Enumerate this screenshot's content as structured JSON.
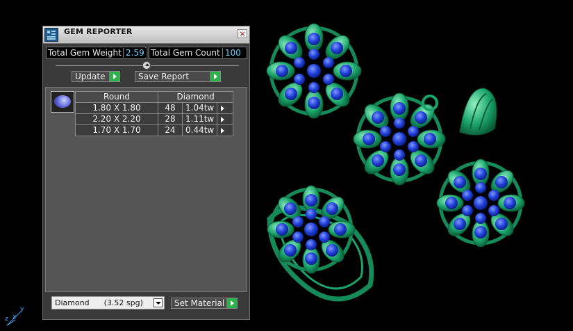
{
  "window": {
    "title": "GEM REPORTER",
    "close_glyph": "×"
  },
  "stats": {
    "total_weight_label": "Total Gem Weight",
    "total_weight_value": "2.59",
    "total_count_label": "Total Gem Count",
    "total_count_value": "100"
  },
  "actions": {
    "update_label": "Update",
    "save_report_label": "Save Report",
    "set_material_label": "Set Material"
  },
  "report": {
    "shape_header": "Round",
    "material_header": "Diamond",
    "rows": [
      {
        "size": "1.80 X 1.80",
        "count": "48",
        "tw": "1.04tw"
      },
      {
        "size": "2.20 X 2.20",
        "count": "28",
        "tw": "1.11tw"
      },
      {
        "size": "1.70 X 1.70",
        "count": "24",
        "tw": "0.44tw"
      }
    ]
  },
  "material": {
    "selected": "Diamond      (3.52 spg)"
  },
  "axis": {
    "z": "z",
    "x": "x",
    "y": "y"
  },
  "colors": {
    "gem_blue": "#1f3fd6",
    "metal_green": "#1aa36a",
    "panel_bg": "#3a3a3a",
    "value_text": "#6fd0ff"
  },
  "icons": [
    "gem-reporter-icon",
    "close-icon",
    "play-icon",
    "gem-thumbnail-icon",
    "dropdown-arrow-icon",
    "axis-gizmo-icon"
  ]
}
